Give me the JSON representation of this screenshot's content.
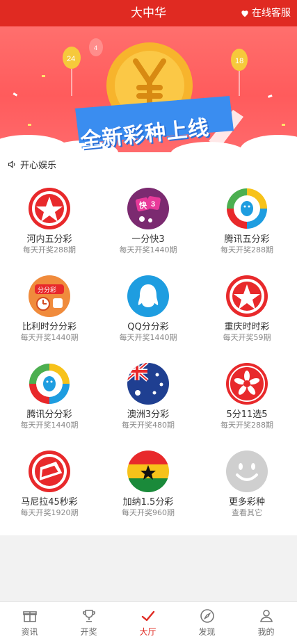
{
  "header": {
    "title": "大中华",
    "service_label": "在线客服",
    "service_icon": "heart-icon"
  },
  "banner": {
    "headline": "全新彩种上线"
  },
  "section": {
    "title": "开心娱乐",
    "title_icon": "speaker-icon"
  },
  "games": [
    {
      "name": "河内五分彩",
      "sub": "每天开奖288期",
      "icon": "hanoi-star-icon"
    },
    {
      "name": "一分快3",
      "sub": "每天开奖1440期",
      "icon": "dice-k3-icon"
    },
    {
      "name": "腾讯五分彩",
      "sub": "每天开奖288期",
      "icon": "tencent-penguin-icon"
    },
    {
      "name": "比利时分分彩",
      "sub": "每天开奖1440期",
      "icon": "belgium-clock-icon"
    },
    {
      "name": "QQ分分彩",
      "sub": "每天开奖1440期",
      "icon": "qq-penguin-icon"
    },
    {
      "name": "重庆时时彩",
      "sub": "每天开奖59期",
      "icon": "chongqing-star-icon"
    },
    {
      "name": "腾讯分分彩",
      "sub": "每天开奖1440期",
      "icon": "tencent-penguin-icon"
    },
    {
      "name": "澳洲3分彩",
      "sub": "每天开奖480期",
      "icon": "australia-flag-icon"
    },
    {
      "name": "5分11选5",
      "sub": "每天开奖288期",
      "icon": "pinwheel-11x5-icon"
    },
    {
      "name": "马尼拉45秒彩",
      "sub": "每天开奖1920期",
      "icon": "manila-badge-icon"
    },
    {
      "name": "加纳1.5分彩",
      "sub": "每天开奖960期",
      "icon": "ghana-flag-icon"
    },
    {
      "name": "更多彩种",
      "sub": "查看其它",
      "icon": "smiley-icon"
    }
  ],
  "tabs": [
    {
      "label": "资讯",
      "icon": "gift-icon"
    },
    {
      "label": "开奖",
      "icon": "trophy-icon"
    },
    {
      "label": "大厅",
      "icon": "checkmark-icon",
      "active": true
    },
    {
      "label": "发现",
      "icon": "compass-icon"
    },
    {
      "label": "我的",
      "icon": "user-icon"
    }
  ],
  "colors": {
    "brand": "#e02a22",
    "banner": "#ff6361",
    "text": "#333333",
    "muted": "#888888"
  }
}
